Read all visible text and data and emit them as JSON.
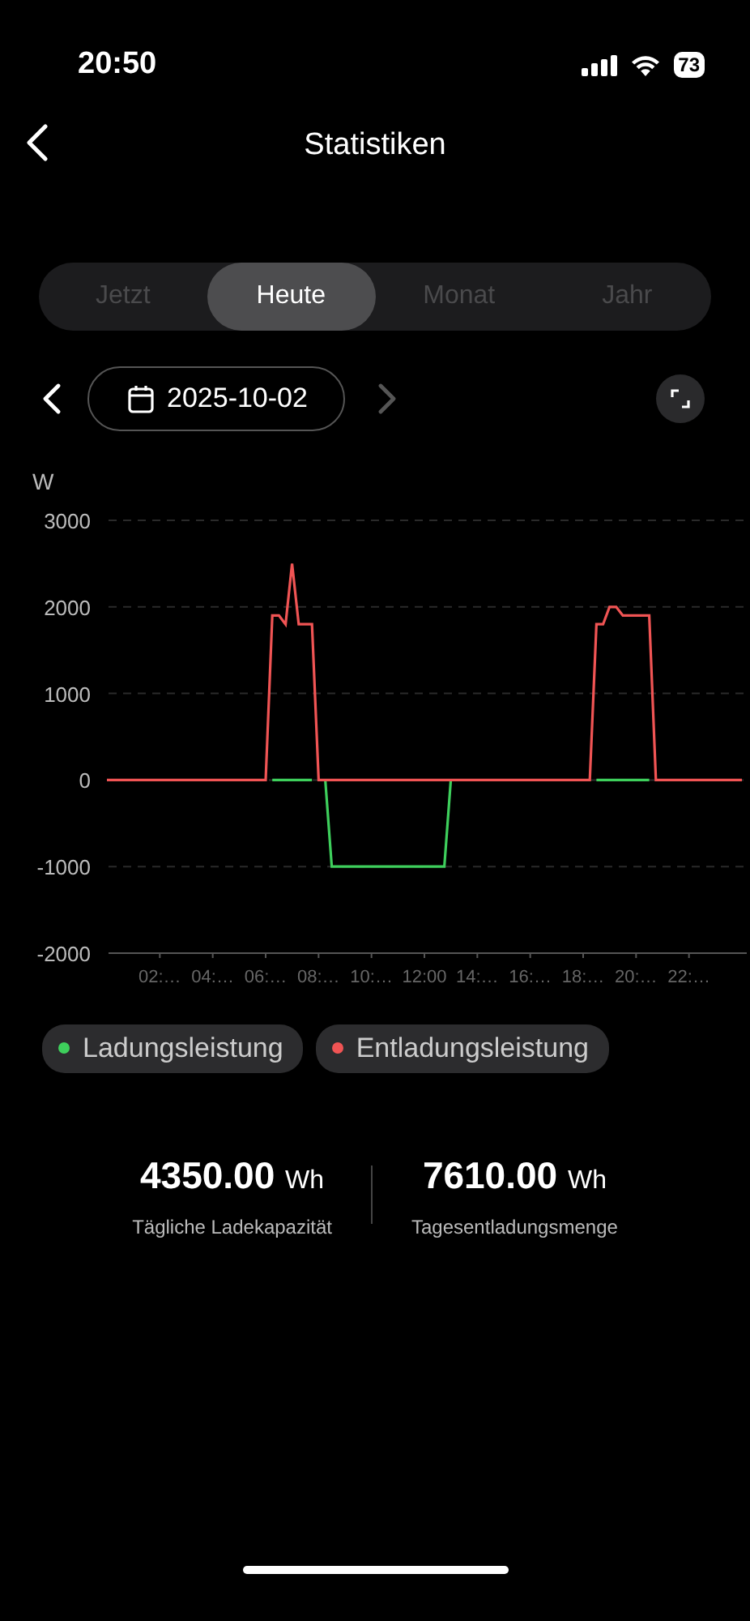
{
  "status_bar": {
    "time": "20:50",
    "battery": "73"
  },
  "header": {
    "title": "Statistiken"
  },
  "tabs": [
    {
      "label": "Jetzt",
      "selected": false
    },
    {
      "label": "Heute",
      "selected": true
    },
    {
      "label": "Monat",
      "selected": false
    },
    {
      "label": "Jahr",
      "selected": false
    }
  ],
  "date_nav": {
    "date": "2025-10-02",
    "prev_disabled": false,
    "next_disabled": true
  },
  "chart": {
    "chart_data": {
      "type": "line",
      "ylabel": "W",
      "categories": [
        null,
        null,
        null,
        null,
        null,
        null,
        null,
        null,
        "02:…",
        null,
        null,
        null,
        null,
        null,
        null,
        null,
        "04:…",
        null,
        null,
        null,
        null,
        null,
        null,
        null,
        "06:…",
        null,
        null,
        null,
        null,
        null,
        null,
        null,
        "08:…",
        null,
        null,
        null,
        null,
        null,
        null,
        null,
        "10:…",
        null,
        null,
        null,
        null,
        null,
        null,
        null,
        "12:00",
        null,
        null,
        null,
        null,
        null,
        null,
        null,
        "14:…",
        null,
        null,
        null,
        null,
        null,
        null,
        null,
        "16:…",
        null,
        null,
        null,
        null,
        null,
        null,
        null,
        "18:…",
        null,
        null,
        null,
        null,
        null,
        null,
        null,
        "20:…",
        null,
        null,
        null,
        null,
        null,
        null,
        null,
        "22:…",
        null,
        null,
        null,
        null,
        null,
        null,
        null,
        null
      ],
      "series": [
        {
          "name": "Ladungsleistung",
          "color": "#3ecf5c",
          "values": [
            null,
            null,
            null,
            null,
            null,
            null,
            null,
            null,
            null,
            null,
            null,
            null,
            null,
            null,
            null,
            null,
            null,
            null,
            null,
            null,
            null,
            null,
            null,
            null,
            null,
            0,
            0,
            0,
            0,
            0,
            0,
            0,
            null,
            0,
            -1000,
            -1000,
            -1000,
            -1000,
            -1000,
            -1000,
            -1000,
            -1000,
            -1000,
            -1000,
            -1000,
            -1000,
            -1000,
            -1000,
            -1000,
            -1000,
            -1000,
            -1000,
            0,
            null,
            null,
            null,
            null,
            null,
            null,
            null,
            null,
            null,
            null,
            null,
            null,
            null,
            null,
            null,
            null,
            null,
            null,
            null,
            null,
            null,
            0,
            0,
            0,
            0,
            0,
            0,
            0,
            0,
            0,
            null,
            null,
            null,
            null,
            null,
            null,
            null,
            null,
            null,
            null,
            null,
            null,
            null,
            null
          ]
        },
        {
          "name": "Entladungsleistung",
          "color": "#f05454",
          "values": [
            0,
            0,
            0,
            0,
            0,
            0,
            0,
            0,
            0,
            0,
            0,
            0,
            0,
            0,
            0,
            0,
            0,
            0,
            0,
            0,
            0,
            0,
            0,
            0,
            0,
            1900,
            1900,
            1800,
            2500,
            1800,
            1800,
            1800,
            0,
            0,
            0,
            0,
            0,
            0,
            0,
            0,
            0,
            0,
            0,
            0,
            0,
            0,
            0,
            0,
            0,
            0,
            0,
            0,
            0,
            0,
            0,
            0,
            0,
            0,
            0,
            0,
            0,
            0,
            0,
            0,
            0,
            0,
            0,
            0,
            0,
            0,
            0,
            0,
            0,
            0,
            1800,
            1800,
            2000,
            2000,
            1900,
            1900,
            1900,
            1900,
            1900,
            0,
            0,
            0,
            0,
            0,
            0,
            0,
            0,
            0,
            0,
            0,
            0,
            0,
            0
          ]
        }
      ],
      "ylim": [
        -2000,
        3000
      ],
      "grid": true,
      "yticks": [
        -2000,
        -1000,
        0,
        1000,
        2000,
        3000
      ]
    }
  },
  "stats": [
    {
      "value": "4350.00",
      "unit": "Wh",
      "label": "Tägliche Ladekapazität"
    },
    {
      "value": "7610.00",
      "unit": "Wh",
      "label": "Tagesentladungsmenge"
    }
  ]
}
